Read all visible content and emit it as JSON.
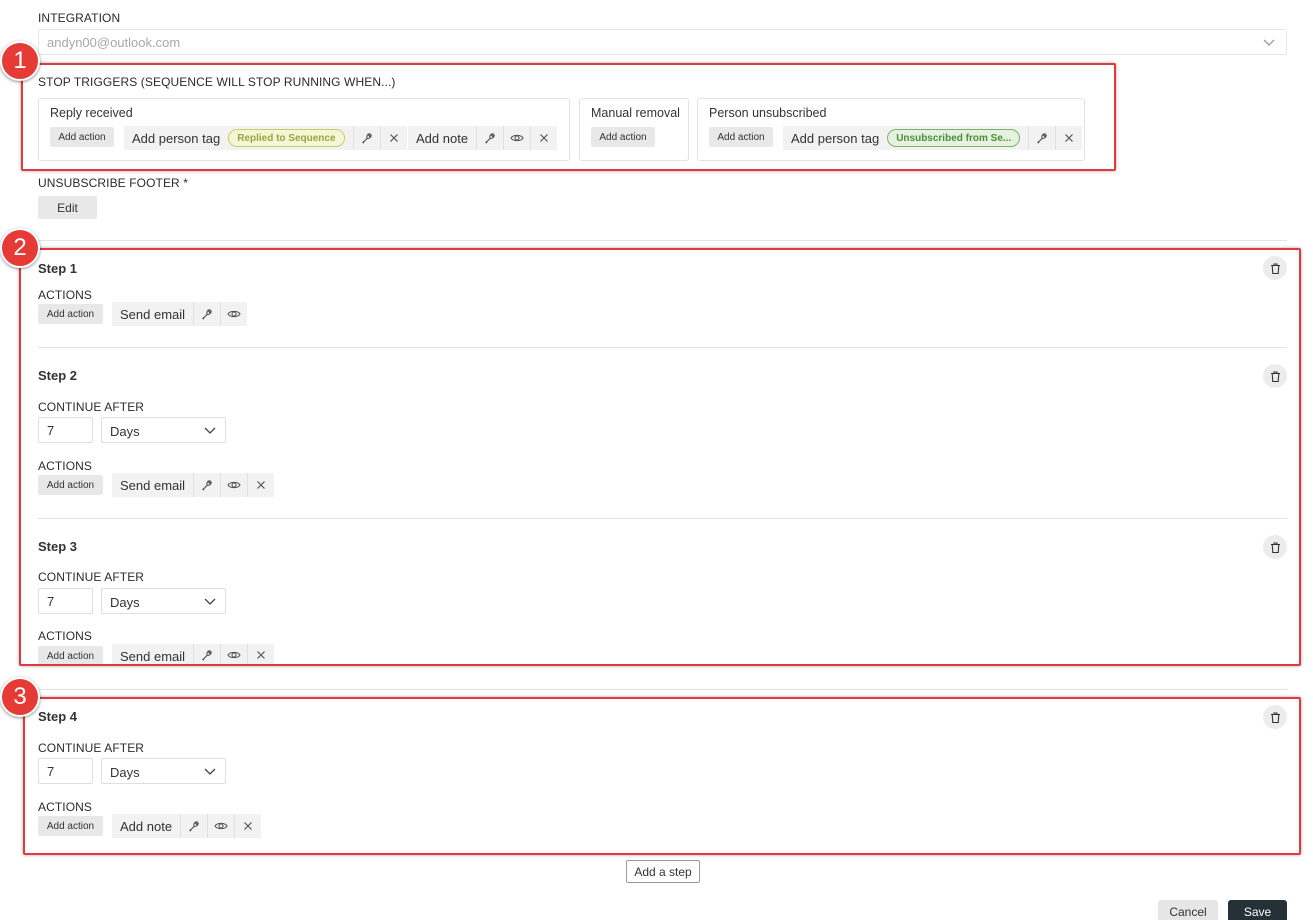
{
  "integration": {
    "label": "INTEGRATION",
    "value": "andyn00@outlook.com"
  },
  "stop_triggers": {
    "label": "STOP TRIGGERS (SEQUENCE WILL STOP RUNNING WHEN...)",
    "reply_received": {
      "title": "Reply received",
      "add_action": "Add action",
      "tag_action_label": "Add person tag",
      "tag": "Replied to Sequence",
      "note_action_label": "Add note"
    },
    "manual_removal": {
      "title": "Manual removal",
      "add_action": "Add action"
    },
    "person_unsubscribed": {
      "title": "Person unsubscribed",
      "add_action": "Add action",
      "tag_action_label": "Add person tag",
      "tag": "Unsubscribed from Se..."
    }
  },
  "unsubscribe_footer": {
    "label": "UNSUBSCRIBE FOOTER *",
    "edit": "Edit"
  },
  "steps": [
    {
      "title": "Step 1",
      "actions_label": "ACTIONS",
      "add_action": "Add action",
      "action": "Send email"
    },
    {
      "title": "Step 2",
      "continue_label": "CONTINUE AFTER",
      "amount": "7",
      "unit": "Days",
      "actions_label": "ACTIONS",
      "add_action": "Add action",
      "action": "Send email"
    },
    {
      "title": "Step 3",
      "continue_label": "CONTINUE AFTER",
      "amount": "7",
      "unit": "Days",
      "actions_label": "ACTIONS",
      "add_action": "Add action",
      "action": "Send email"
    },
    {
      "title": "Step 4",
      "continue_label": "CONTINUE AFTER",
      "amount": "7",
      "unit": "Days",
      "actions_label": "ACTIONS",
      "add_action": "Add action",
      "action": "Add note"
    }
  ],
  "callouts": [
    "1",
    "2",
    "3"
  ],
  "footer": {
    "add_step": "Add a step",
    "cancel": "Cancel",
    "save": "Save"
  },
  "colors": {
    "callout_red": "#e0393e",
    "save_bg": "#243238",
    "tag_yellow": "#9aa43a",
    "tag_green": "#4e8c3c"
  }
}
